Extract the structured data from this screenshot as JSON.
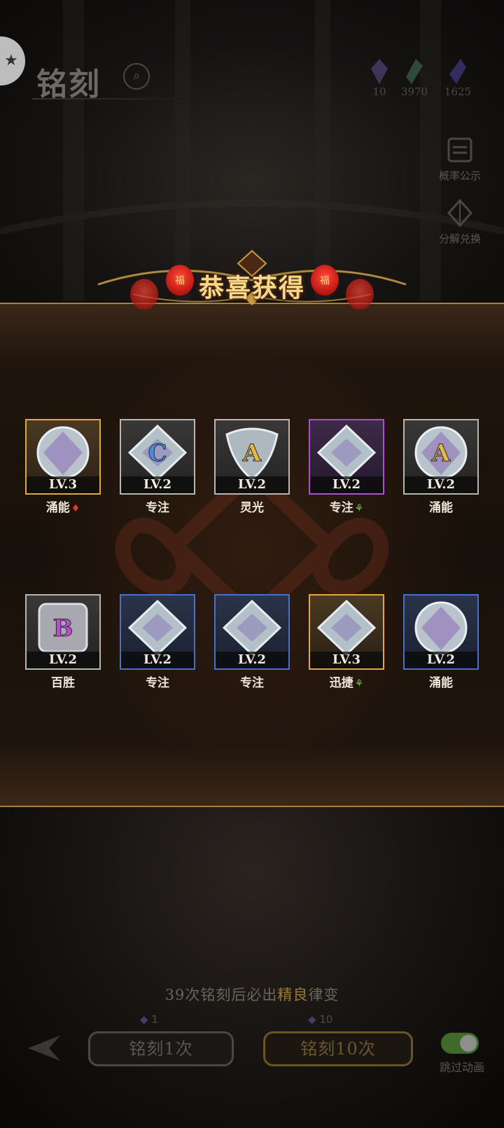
{
  "header": {
    "title": "铭刻",
    "search_icon": "search-icon",
    "resources": [
      {
        "icon": "purple-gem-icon",
        "value": "10",
        "color": "#5a4a8a"
      },
      {
        "icon": "green-gem-icon",
        "value": "3970",
        "color": "#3a6a4a"
      },
      {
        "icon": "violet-crystal-icon",
        "value": "1625",
        "color": "#4a3a8a"
      }
    ]
  },
  "side_buttons": [
    {
      "label": "概率公示",
      "icon": "probability-icon"
    },
    {
      "label": "分解兑换",
      "icon": "decompose-icon"
    }
  ],
  "reward_panel": {
    "title": "恭喜获得",
    "lantern_char": "福",
    "items": [
      {
        "level": "LV.3",
        "name": "涌能",
        "gem": "round",
        "letter": "",
        "frame": "gold",
        "mark": "red"
      },
      {
        "level": "LV.2",
        "name": "专注",
        "gem": "diamond",
        "letter": "C",
        "frame": "silver",
        "mark": ""
      },
      {
        "level": "LV.2",
        "name": "灵光",
        "gem": "shield",
        "letter": "A",
        "frame": "silver",
        "mark": ""
      },
      {
        "level": "LV.2",
        "name": "专注",
        "gem": "diamond",
        "letter": "",
        "frame": "purple",
        "mark": "green"
      },
      {
        "level": "LV.2",
        "name": "涌能",
        "gem": "round",
        "letter": "A",
        "frame": "silver",
        "mark": ""
      },
      {
        "level": "LV.2",
        "name": "百胜",
        "gem": "square",
        "letter": "B",
        "frame": "silver",
        "mark": ""
      },
      {
        "level": "LV.2",
        "name": "专注",
        "gem": "diamond",
        "letter": "",
        "frame": "blue",
        "mark": ""
      },
      {
        "level": "LV.2",
        "name": "专注",
        "gem": "diamond",
        "letter": "",
        "frame": "blue",
        "mark": ""
      },
      {
        "level": "LV.3",
        "name": "迅捷",
        "gem": "diamond",
        "letter": "",
        "frame": "gold",
        "mark": "green"
      },
      {
        "level": "LV.2",
        "name": "涌能",
        "gem": "round",
        "letter": "",
        "frame": "blue",
        "mark": ""
      }
    ]
  },
  "footer": {
    "hint_pre": "39次铭刻后必出",
    "hint_highlight": "精良",
    "hint_post": "律变",
    "cost_single": "1",
    "cost_ten": "10",
    "engrave_once": "铭刻1次",
    "engrave_ten": "铭刻10次",
    "skip_label": "跳过动画",
    "skip_on": true
  }
}
